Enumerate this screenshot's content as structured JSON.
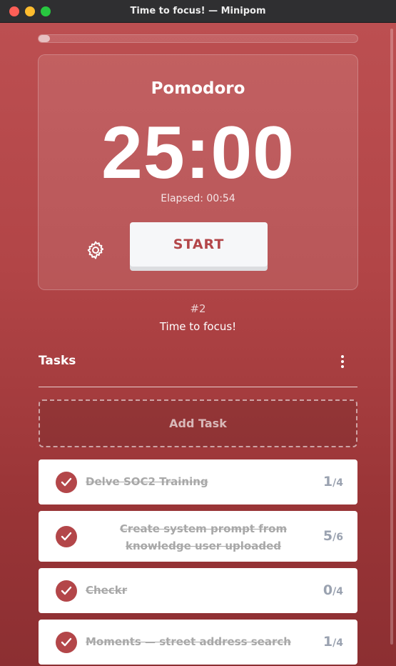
{
  "window": {
    "title": "Time to focus! — Minipom"
  },
  "progress": {
    "fraction": 0.036
  },
  "timer": {
    "mode": "Pomodoro",
    "time": "25:00",
    "elapsed": "Elapsed: 00:54",
    "start_label": "START"
  },
  "session": {
    "number": "#2",
    "label": "Time to focus!"
  },
  "tasks": {
    "title": "Tasks",
    "add_label": "Add Task",
    "items": [
      {
        "text": "Delve SOC2 Training",
        "done": "1",
        "total": "/4"
      },
      {
        "text": "Create system prompt from knowledge user uploaded",
        "done": "5",
        "total": "/6"
      },
      {
        "text": "Checkr",
        "done": "0",
        "total": "/4"
      },
      {
        "text": "Moments — street address search",
        "done": "1",
        "total": "/4"
      }
    ]
  },
  "colors": {
    "accent": "#b34649",
    "start_bg": "#f6f7f9"
  },
  "icons": {
    "settings": "gear-icon",
    "menu": "more-vertical-icon",
    "check": "check-circle-icon"
  }
}
